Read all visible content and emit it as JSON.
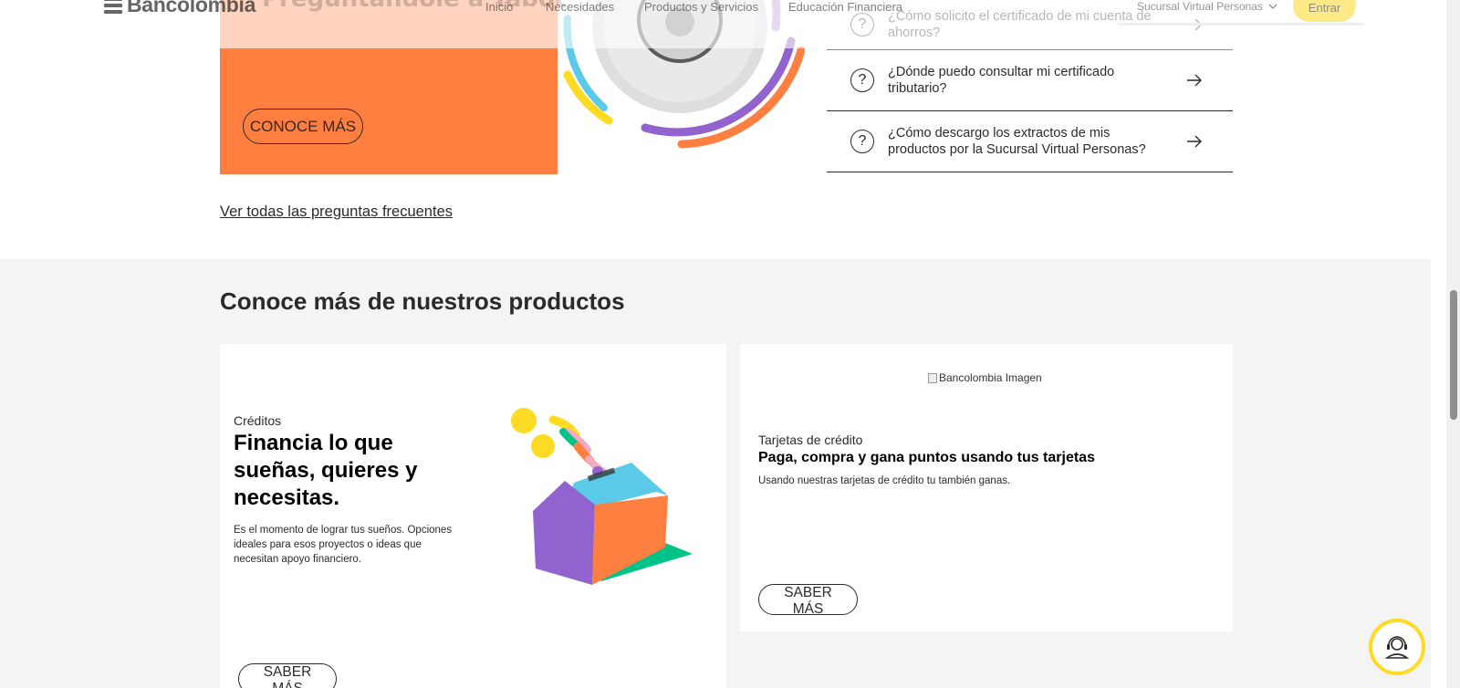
{
  "header": {
    "logo_text": "Bancolombia",
    "nav": [
      "Inicio",
      "Necesidades",
      "Productos y Servicios",
      "Educación Financiera"
    ],
    "sucursal": "Sucursal Virtual Personas",
    "login": "Entrar"
  },
  "promo": {
    "title": "Preguntándole a Tabot",
    "button": "CONOCE MÁS"
  },
  "faq": {
    "items": [
      "¿Cómo solicito el certificado de mi cuenta de ahorros?",
      "¿Dónde puedo consultar mi certificado tributario?",
      "¿Cómo descargo los extractos de mis productos por la Sucursal Virtual Personas?"
    ],
    "see_all": "Ver todas las preguntas frecuentes"
  },
  "products": {
    "title": "Conoce más de nuestros productos",
    "credits": {
      "kicker": "Créditos",
      "headline": "Financia lo que sueñas, quieres y necesitas.",
      "description": "Es el momento de lograr tus sueños. Opciones ideales para esos proyectos o ideas que necesitan apoyo financiero.",
      "button": "SABER MÁS"
    },
    "cards": {
      "image_alt": "Bancolombia Imagen",
      "kicker": "Tarjetas de crédito",
      "headline": "Paga, compra y gana puntos usando tus tarjetas",
      "description": "Usando nuestras tarjetas de crédito tu también ganas.",
      "button": "SABER MÁS"
    }
  },
  "colors": {
    "orange": "#ff7f41",
    "peach": "#ffb99a",
    "yellow": "#fdda24",
    "purple": "#9163ce",
    "blue": "#5bc9e8",
    "green": "#00c389"
  },
  "icons": [
    "logo-icon",
    "chevron-down-icon",
    "question-icon",
    "arrow-right-icon",
    "chat-support-icon"
  ]
}
